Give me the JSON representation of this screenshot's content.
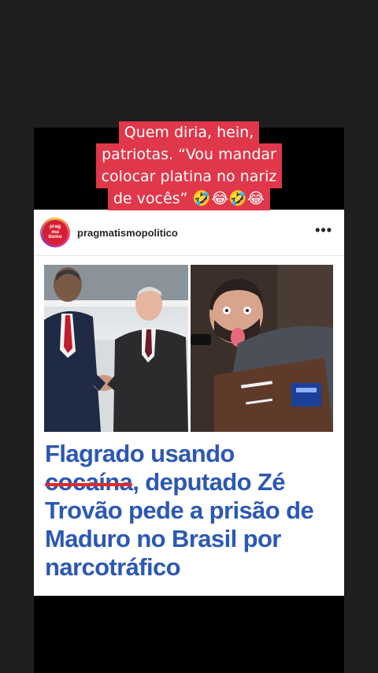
{
  "caption": {
    "lines": [
      "Quem diria, hein,",
      "patriotas. “Vou mandar",
      "colocar platina no nariz",
      "de vocês” 🤣😂🤣😂"
    ]
  },
  "post": {
    "avatar_text": "prag\nma\ntismo",
    "username": "pragmatismopolitico",
    "more_label": "•••",
    "headline": {
      "line1": "Flagrado usando",
      "struck_word": "cocaína",
      "line2_rest": ", deputado Zé",
      "line3": "Trovão pede a prisão de",
      "line4": "Maduro no Brasil por",
      "line5": "narcotráfico"
    }
  },
  "colors": {
    "caption_bg": "#e0374a",
    "headline_text": "#2c58b3",
    "strike_line": "#e02a2a"
  }
}
